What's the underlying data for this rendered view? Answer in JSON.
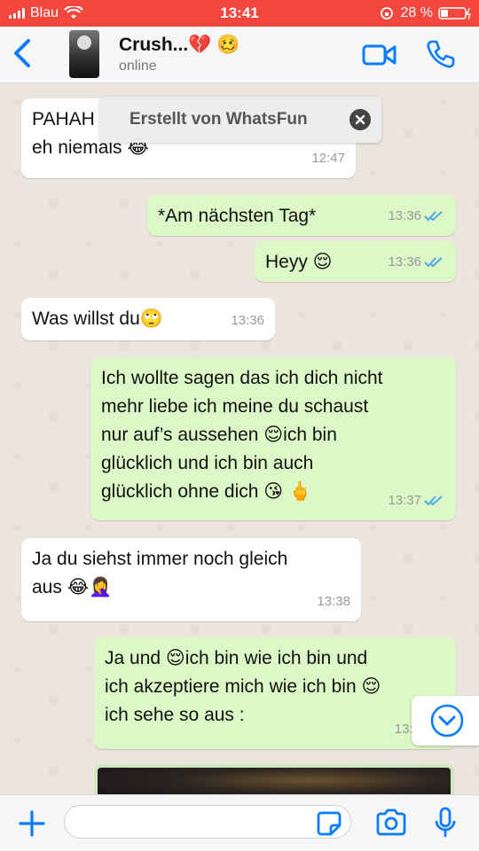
{
  "status_bar": {
    "carrier": "Blau",
    "time": "13:41",
    "battery": "28 %"
  },
  "header": {
    "contact_name": "Crush...💔 🥴",
    "contact_status": "online"
  },
  "toast": {
    "text": "Erstellt von WhatsFun"
  },
  "messages": [
    {
      "direction": "incoming",
      "text_line1": "PAHAH",
      "text_line2": "eh niemals 😂",
      "time": "12:47"
    },
    {
      "direction": "outgoing",
      "text": "*Am nächsten Tag*",
      "time": "13:36",
      "read": true
    },
    {
      "direction": "outgoing",
      "text": "Heyy 😌",
      "time": "13:36",
      "read": true
    },
    {
      "direction": "incoming",
      "text": "Was willst du🙄",
      "time": "13:36"
    },
    {
      "direction": "outgoing",
      "text_line1": "Ich wollte sagen das ich dich nicht",
      "text_line2": "mehr liebe ich meine du schaust",
      "text_line3": "nur auf’s aussehen 😌ich bin",
      "text_line4": "glücklich und ich bin auch",
      "text_line5": "glücklich ohne dich 😘 🖕",
      "time": "13:37",
      "read": true
    },
    {
      "direction": "incoming",
      "text_line1": "Ja du siehst immer noch gleich",
      "text_line2": "aus 😂🤦‍♀️",
      "time": "13:38"
    },
    {
      "direction": "outgoing",
      "text_line1": "Ja und 😌ich bin wie ich bin und",
      "text_line2": "ich akzeptiere mich wie ich bin 😌",
      "text_line3": "ich sehe so aus :",
      "time": "13:3"
    }
  ],
  "input_bar": {
    "placeholder": ""
  },
  "colors": {
    "status_bar": "#f3473e",
    "accent": "#0a7cff",
    "outgoing_bubble": "#dcf8c6",
    "incoming_bubble": "#ffffff",
    "read_ticks": "#4fa9e8"
  },
  "icons": [
    "back-chevron-icon",
    "video-call-icon",
    "phone-icon",
    "close-icon",
    "chevron-down-icon",
    "plus-icon",
    "sticker-icon",
    "camera-icon",
    "microphone-icon",
    "read-ticks-icon"
  ]
}
